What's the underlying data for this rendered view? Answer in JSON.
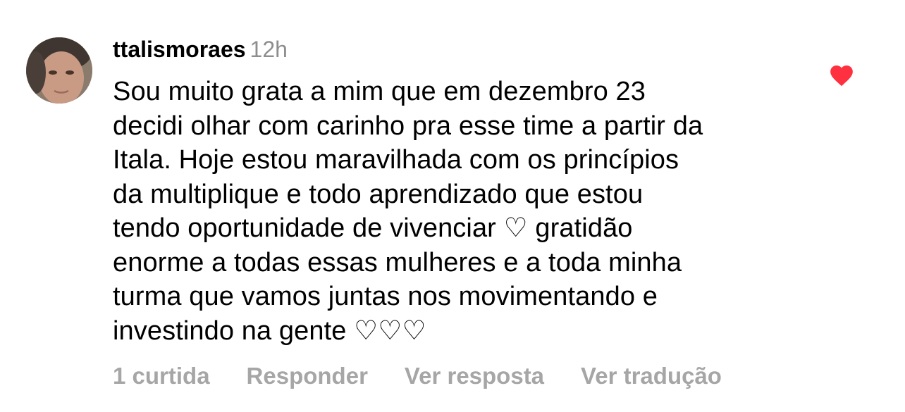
{
  "comment": {
    "username": "ttalismoraes",
    "timestamp": "12h",
    "text": "Sou muito grata a mim que em dezembro 23\ndecidi olhar com carinho pra esse time a partir da\nItala. Hoje estou maravilhada com os princípios\nda multiplique e todo aprendizado que estou\ntendo oportunidade de vivenciar ♡ gratidão\nenorme a todas essas mulheres e a toda minha\nturma que vamos juntas nos movimentando e\ninvestindo na gente ♡♡♡",
    "liked": true,
    "like_icon": "heart-filled-icon",
    "like_color": "#ff3040",
    "actions": {
      "likes": "1 curtida",
      "reply": "Responder",
      "view_replies": "Ver resposta",
      "translate": "Ver tradução"
    }
  },
  "colors": {
    "text": "#000000",
    "muted": "#8e8e8e",
    "action": "#a6a6a6",
    "heart": "#ff3040"
  }
}
